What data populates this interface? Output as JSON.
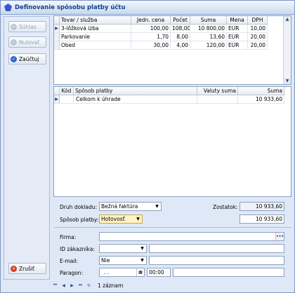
{
  "window": {
    "title": "Definovanie spôsobu platby účtu"
  },
  "left_panel": {
    "approve_label": "Súhlas",
    "reset_label": "Nulovať",
    "post_label": "Zaúčtuj",
    "cancel_label": "Zrušiť"
  },
  "items_table": {
    "columns": [
      "Tovar / služba",
      "Jedn. cena",
      "Počet",
      "Suma",
      "Mena",
      "DPH"
    ],
    "rows": [
      [
        "3-lôžková izba",
        "100,00",
        "108,00",
        "10 800,00",
        "EUR",
        "10,00"
      ],
      [
        "Parkovanie",
        "1,70",
        "8,00",
        "13,60",
        "EUR",
        "20,00"
      ],
      [
        "Obed",
        "30,00",
        "4,00",
        "120,00",
        "EUR",
        "20,00"
      ]
    ]
  },
  "payment_table": {
    "columns": [
      "Kód",
      "Spôsob platby",
      "Valuty suma",
      "Suma"
    ],
    "rows": [
      [
        "",
        "Celkom k úhrade",
        "",
        "10 933,60"
      ]
    ]
  },
  "form": {
    "doc_type_label": "Druh dokladu:",
    "doc_type_value": "Bežná faktúra",
    "pay_method_label": "Spôsob platby:",
    "pay_method_value": "Hotovosť",
    "remainder_label": "Zostatok:",
    "remainder_value": "10 933,60",
    "amount_value": "10 933,60",
    "company_label": "Firma:",
    "customer_id_label": "ID zákazníka:",
    "email_label": "E-mail:",
    "email_value": "Nie",
    "receipt_label": "Paragon:",
    "receipt_date": ". .",
    "receipt_time": "00:00"
  },
  "navigator": {
    "record_count": "1 záznam"
  },
  "colors": {
    "window_bg": "#dfe8f6",
    "title_text": "#15428b",
    "highlight": "#fff3c4",
    "border": "#8aa0c0"
  }
}
